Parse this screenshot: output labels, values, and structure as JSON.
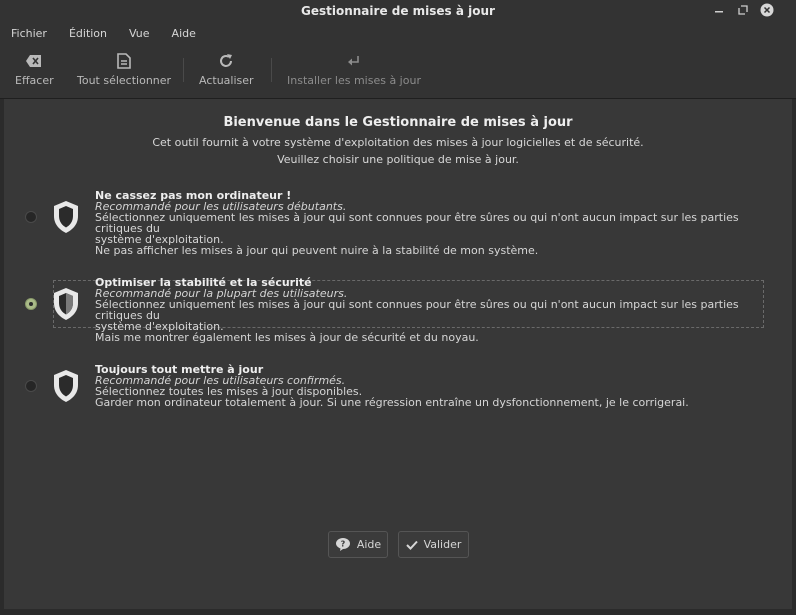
{
  "window": {
    "title": "Gestionnaire de mises à jour",
    "controls": [
      "minimize-icon",
      "maximize-icon",
      "close-icon"
    ]
  },
  "menu": {
    "items": [
      "Fichier",
      "Édition",
      "Vue",
      "Aide"
    ]
  },
  "toolbar": {
    "clear_label": "Effacer",
    "select_all_label": "Tout sélectionner",
    "refresh_label": "Actualiser",
    "install_label": "Installer les mises à jour"
  },
  "welcome": {
    "title": "Bienvenue dans le Gestionnaire de mises à jour",
    "line1": "Cet outil fournit à votre système d'exploitation des mises à jour logicielles et de sécurité.",
    "line2": "Veuillez choisir une politique de mise à jour."
  },
  "options": [
    {
      "title": "Ne cassez pas mon ordinateur !",
      "subtitle": "Recommandé pour les utilisateurs débutants.",
      "desc1": "Sélectionnez uniquement les mises à jour qui sont connues pour être sûres ou qui n'ont aucun impact sur les parties critiques du",
      "desc2": "système d'exploitation.",
      "desc3": "Ne pas afficher les mises à jour qui peuvent nuire à la stabilité de mon système.",
      "selected": false
    },
    {
      "title": "Optimiser la stabilité et la sécurité",
      "subtitle": "Recommandé pour la plupart des utilisateurs.",
      "desc1": "Sélectionnez uniquement les mises à jour qui sont connues pour être sûres ou qui n'ont aucun impact sur les parties critiques du",
      "desc2": "système d'exploitation.",
      "desc3": "Mais me montrer également les mises à jour de sécurité et du noyau.",
      "selected": true
    },
    {
      "title": "Toujours tout mettre à jour",
      "subtitle": "Recommandé pour les utilisateurs confirmés.",
      "desc1": "Sélectionnez toutes les mises à jour disponibles.",
      "desc2": "Garder mon ordinateur totalement à jour. Si une régression entraîne un dysfonctionnement, je le corrigerai.",
      "selected": false
    }
  ],
  "buttons": {
    "help_label": "Aide",
    "ok_label": "Valider"
  },
  "colors": {
    "background": "#383838",
    "accent_radio": "#aabb88"
  }
}
